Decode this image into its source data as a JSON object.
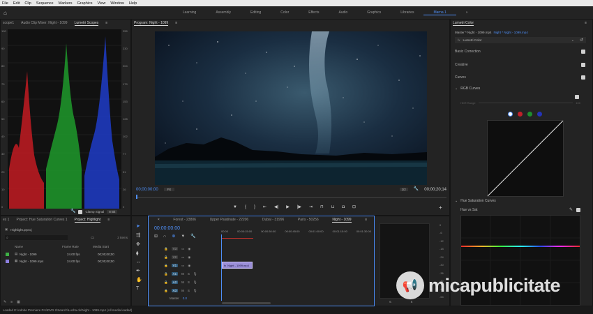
{
  "menubar": {
    "items": [
      "File",
      "Edit",
      "Clip",
      "Sequence",
      "Markers",
      "Graphics",
      "View",
      "Window",
      "Help"
    ]
  },
  "workspaces": {
    "items": [
      "Learning",
      "Assembly",
      "Editing",
      "Color",
      "Effects",
      "Audio",
      "Graphics",
      "Libraries"
    ],
    "active": "Marna 1",
    "more": "»"
  },
  "scopes": {
    "tabs": [
      "scope1",
      "Audio Clip Mixer: Night - 1099",
      "Lumetri Scopes"
    ],
    "scale_right": [
      "255",
      "230",
      "204",
      "179",
      "153",
      "128",
      "102",
      "77",
      "51",
      "26",
      "0"
    ],
    "scale_left": [
      "100",
      "90",
      "80",
      "70",
      "60",
      "50",
      "40",
      "30",
      "20",
      "10",
      "0"
    ],
    "clamp_label": "Clamp Signal",
    "bit_depth": "8 Bit"
  },
  "program": {
    "title": "Program: Night - 1099",
    "timecode": "00;00;00;00",
    "fit": "Fit",
    "quality": "1/2",
    "duration": "00;00;20;14"
  },
  "lumetri": {
    "title": "Lumetri Color",
    "master": "Master * Night - 1099.mp4",
    "clip": "Night * Night - 1099.mp4",
    "effect": "Lumetri Color",
    "sections": [
      "Basic Correction",
      "Creative",
      "Curves"
    ],
    "rgb_curves": "RGB Curves",
    "hdr_range": "HDR Range",
    "hdr_value": "100",
    "hue_sat_curves": "Hue Saturation Curves",
    "hue_vs_sat": "Hue vs Sat"
  },
  "project": {
    "tabs": [
      "es 1",
      "Project: Hue Saturation Curves 1",
      "Project: Highlight"
    ],
    "file": "Highlight.prproj",
    "items_count": "2 Items",
    "columns": [
      "Name",
      "Frame Rate",
      "Media Start"
    ],
    "rows": [
      {
        "name": "Night - 1099",
        "rate": "24.00 fps",
        "start": "00;00;00;00"
      },
      {
        "name": "Night - 1099.mp4",
        "rate": "24.00 fps",
        "start": "00;00;00;00"
      }
    ]
  },
  "timeline": {
    "tabs": [
      "Forest - 23806",
      "Upper Palatinate - 22206",
      "Dubai - 31996",
      "Paris - 50256",
      "Night - 1099"
    ],
    "timecode": "00:00:00:00",
    "ruler": [
      "00:00",
      "00:00:15:00",
      "00:00:30:00",
      "00:00:45:00",
      "00:01:00:00",
      "00:01:15:00",
      "00:01:30:00"
    ],
    "video_tracks": [
      "V3",
      "V2",
      "V1"
    ],
    "audio_tracks": [
      "A1",
      "A2",
      "A3"
    ],
    "master": "Master",
    "master_value": "0.0",
    "clip": "Night - 1099.mp4",
    "levels": [
      "0",
      "-6",
      "-12",
      "-18",
      "-24",
      "-30",
      "-36",
      "-42",
      "-48",
      "-54"
    ],
    "level_footer": [
      "S",
      "S"
    ]
  },
  "status": "Loaded E:\\Adobe Premiere Pro\\DVD 2\\Search\\Lucha dx\\Night - 1099.mp4 (All media loaded)",
  "watermark": "micapublicitate",
  "colors": {
    "accent": "#4e8ef7",
    "panel": "#232323",
    "clip": "#9b8fd8"
  }
}
